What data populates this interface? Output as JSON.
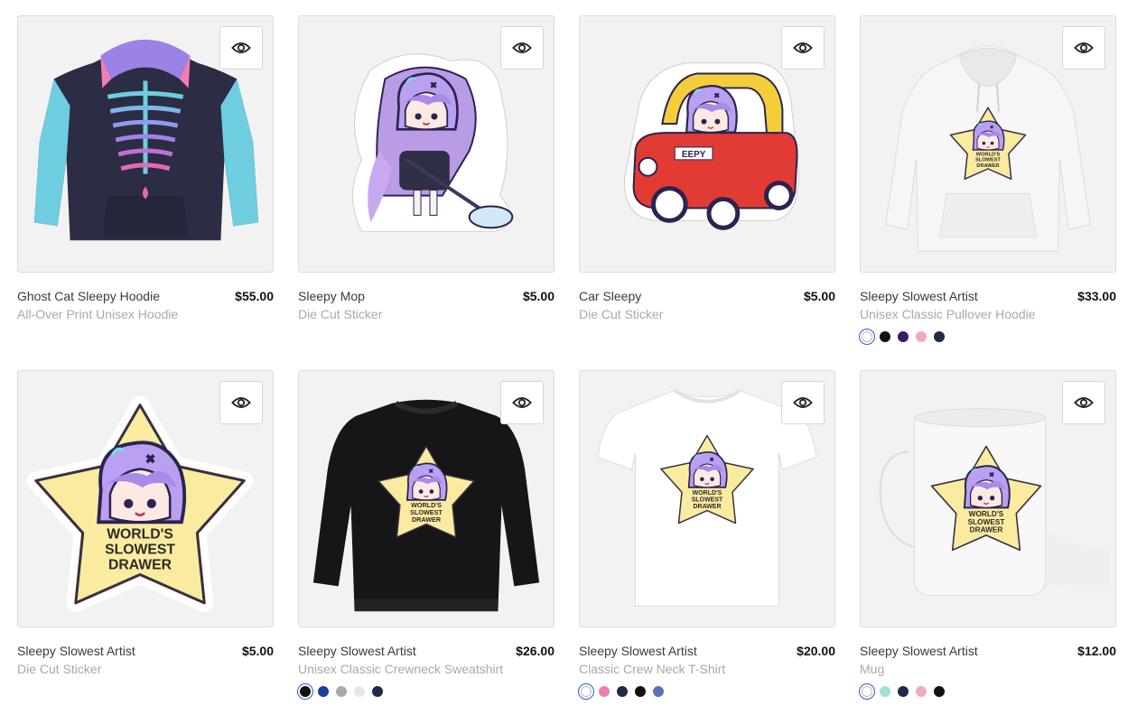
{
  "products": [
    {
      "name": "Ghost Cat Sleepy Hoodie",
      "type": "All-Over Print Unisex Hoodie",
      "price": "$55.00",
      "art": "hoodie-allover",
      "colors": []
    },
    {
      "name": "Sleepy Mop",
      "type": "Die Cut Sticker",
      "price": "$5.00",
      "art": "sticker-mop",
      "colors": []
    },
    {
      "name": "Car Sleepy",
      "type": "Die Cut Sticker",
      "price": "$5.00",
      "art": "sticker-car",
      "colors": []
    },
    {
      "name": "Sleepy Slowest Artist",
      "type": "Unisex Classic Pullover Hoodie",
      "price": "$33.00",
      "art": "hoodie-white",
      "colors": [
        "#ffffff",
        "#111111",
        "#3b1a6b",
        "#f2a9c4",
        "#1f2a44"
      ]
    },
    {
      "name": "Sleepy Slowest Artist",
      "type": "Die Cut Sticker",
      "price": "$5.00",
      "art": "sticker-star",
      "colors": []
    },
    {
      "name": "Sleepy Slowest Artist",
      "type": "Unisex Classic Crewneck Sweatshirt",
      "price": "$26.00",
      "art": "sweatshirt-black",
      "colors": [
        "#111111",
        "#1c3f9c",
        "#a9a9a9",
        "#e6e6e6",
        "#1f2a44"
      ]
    },
    {
      "name": "Sleepy Slowest Artist",
      "type": "Classic Crew Neck T-Shirt",
      "price": "$20.00",
      "art": "tshirt-white",
      "colors": [
        "#ffffff",
        "#f07fb0",
        "#1f2a44",
        "#111111",
        "#5a72b8"
      ]
    },
    {
      "name": "Sleepy Slowest Artist",
      "type": "Mug",
      "price": "$12.00",
      "art": "mug",
      "colors": [
        "#ffffff",
        "#9ee3d6",
        "#1f2a44",
        "#f2a9c4",
        "#111111"
      ]
    }
  ],
  "icons": {
    "quick_view": "eye-icon"
  },
  "star_text": {
    "line1": "WORLD'S",
    "line2": "SLOWEST",
    "line3": "DRAWER"
  },
  "car_plate": "EEPY"
}
